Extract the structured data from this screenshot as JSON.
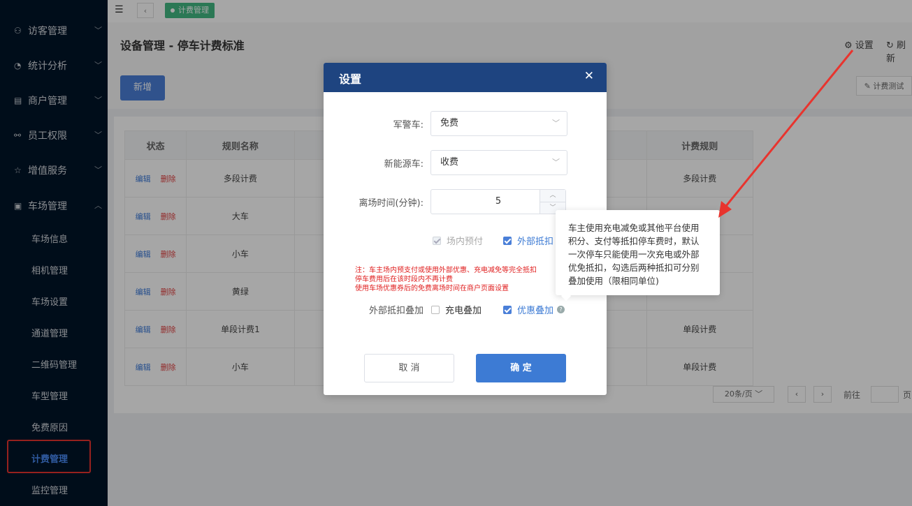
{
  "sidebar": {
    "menus": [
      {
        "icon": "user-cog-icon",
        "label": "访客管理"
      },
      {
        "icon": "pie-chart-icon",
        "label": "统计分析"
      },
      {
        "icon": "store-icon",
        "label": "商户管理"
      },
      {
        "icon": "staff-icon",
        "label": "员工权限"
      },
      {
        "icon": "star-icon",
        "label": "增值服务"
      },
      {
        "icon": "parking-icon",
        "label": "车场管理"
      }
    ],
    "submenu": [
      "车场信息",
      "相机管理",
      "车场设置",
      "通道管理",
      "二维码管理",
      "车型管理",
      "免费原因",
      "计费管理",
      "监控管理"
    ],
    "active_submenu": "计费管理"
  },
  "topbar": {
    "tab_label": "计费管理"
  },
  "page": {
    "title": "设备管理 - 停车计费标准",
    "settings_label": "设置",
    "refresh_label": "刷新",
    "add_button": "新增",
    "test_button": "计费测试"
  },
  "table": {
    "headers": [
      "状态",
      "规则名称",
      "",
      "计费规则"
    ],
    "edit_label": "编辑",
    "delete_label": "删除",
    "rows": [
      {
        "name": "多段计费",
        "rule": "多段计费"
      },
      {
        "name": "大车",
        "rule": ""
      },
      {
        "name": "小车",
        "rule": ""
      },
      {
        "name": "黄绿",
        "rule": ""
      },
      {
        "name": "单段计费1",
        "rule": "单段计费"
      },
      {
        "name": "小车",
        "rule": "单段计费"
      }
    ]
  },
  "pager": {
    "page_size": "20条/页",
    "goto_label": "前往",
    "page_unit": "页"
  },
  "dialog": {
    "title": "设置",
    "fields": {
      "military_label": "军警车:",
      "military_value": "免费",
      "new_energy_label": "新能源车:",
      "new_energy_value": "收费",
      "leave_time_label": "离场时间(分钟):",
      "leave_time_value": "5"
    },
    "checkboxes": {
      "prepay_label": "场内预付",
      "external_label": "外部抵扣",
      "stack_label": "外部抵扣叠加",
      "charge_stack_label": "充电叠加",
      "coupon_stack_label": "优惠叠加"
    },
    "note_lines": [
      "注：车主场内预支付或使用外部优惠、充电减免等完全抵扣",
      "停车费用后在该时段内不再计费",
      "使用车场优惠券后的免费离场时间在商户页面设置"
    ],
    "cancel_label": "取 消",
    "confirm_label": "确 定"
  },
  "tooltip": {
    "text": "车主使用充电减免或其他平台使用积分、支付等抵扣停车费时，默认一次停车只能使用一次充电或外部优免抵扣，勾选后两种抵扣可分别叠加使用（限相同单位)"
  },
  "colors": {
    "sidebar_bg": "#001529",
    "dialog_header": "#1e4480",
    "primary": "#3d7bd4",
    "highlight_red": "#e8342e"
  }
}
